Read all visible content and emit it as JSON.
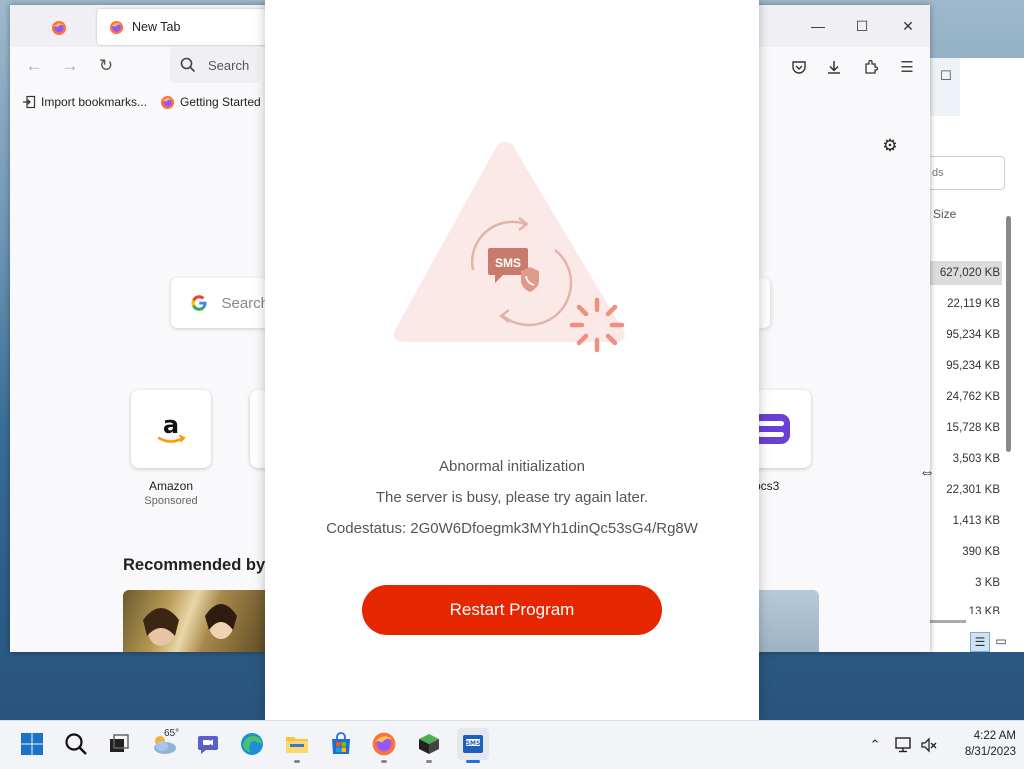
{
  "explorer": {
    "search_placeholder": "ds",
    "size_header": "Size",
    "sizes": [
      "627,020 KB",
      "22,119 KB",
      "95,234 KB",
      "95,234 KB",
      "24,762 KB",
      "15,728 KB",
      "3,503 KB",
      "22,301 KB",
      "1,413 KB",
      "390 KB",
      "3 KB",
      "13 KB"
    ]
  },
  "firefox": {
    "tab_title": "New Tab",
    "search_placeholder": "Search",
    "bookmarks": [
      "Import bookmarks...",
      "Getting Started"
    ],
    "google_search_placeholder": "Search",
    "tiles": [
      {
        "label": "Amazon",
        "sub": "Sponsored"
      },
      {
        "label": "rpcs3",
        "sub": ""
      }
    ],
    "recommended_title": "Recommended by"
  },
  "dialog": {
    "badge_text": "SMS",
    "title": "Abnormal initialization",
    "message": "The server is busy, please try again later.",
    "codestatus": "Codestatus: 2G0W6Dfoegmk3MYh1dinQc53sG4/Rg8W",
    "button_label": "Restart Program",
    "accent_color": "#e52600"
  },
  "taskbar": {
    "weather_temp": "65°",
    "time": "4:22 AM",
    "date": "8/31/2023"
  }
}
